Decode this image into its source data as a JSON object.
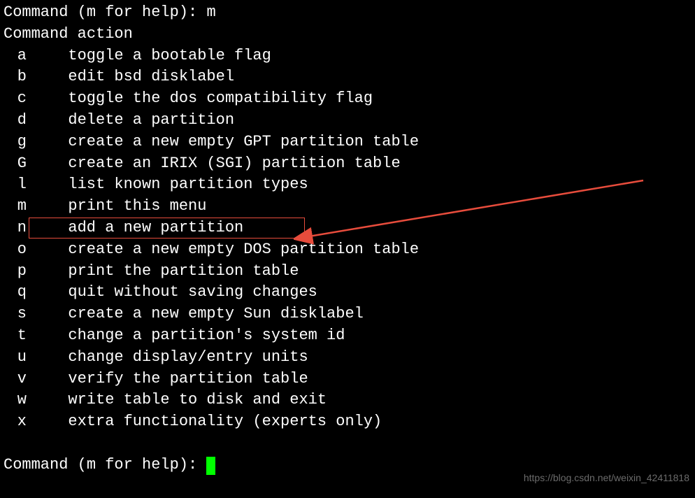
{
  "prompt_line_1": "Command (m for help): m",
  "header": "Command action",
  "menu": [
    {
      "key": "a",
      "desc": "toggle a bootable flag",
      "highlighted": false
    },
    {
      "key": "b",
      "desc": "edit bsd disklabel",
      "highlighted": false
    },
    {
      "key": "c",
      "desc": "toggle the dos compatibility flag",
      "highlighted": false
    },
    {
      "key": "d",
      "desc": "delete a partition",
      "highlighted": false
    },
    {
      "key": "g",
      "desc": "create a new empty GPT partition table",
      "highlighted": false
    },
    {
      "key": "G",
      "desc": "create an IRIX (SGI) partition table",
      "highlighted": false
    },
    {
      "key": "l",
      "desc": "list known partition types",
      "highlighted": false
    },
    {
      "key": "m",
      "desc": "print this menu",
      "highlighted": false
    },
    {
      "key": "n",
      "desc": "add a new partition",
      "highlighted": true
    },
    {
      "key": "o",
      "desc": "create a new empty DOS partition table",
      "highlighted": false
    },
    {
      "key": "p",
      "desc": "print the partition table",
      "highlighted": false
    },
    {
      "key": "q",
      "desc": "quit without saving changes",
      "highlighted": false
    },
    {
      "key": "s",
      "desc": "create a new empty Sun disklabel",
      "highlighted": false
    },
    {
      "key": "t",
      "desc": "change a partition's system id",
      "highlighted": false
    },
    {
      "key": "u",
      "desc": "change display/entry units",
      "highlighted": false
    },
    {
      "key": "v",
      "desc": "verify the partition table",
      "highlighted": false
    },
    {
      "key": "w",
      "desc": "write table to disk and exit",
      "highlighted": false
    },
    {
      "key": "x",
      "desc": "extra functionality (experts only)",
      "highlighted": false
    }
  ],
  "prompt_line_2": "Command (m for help): ",
  "watermark": "https://blog.csdn.net/weixin_42411818",
  "annotation": {
    "arrow_color": "#e74c3c",
    "box_color": "#e74c3c"
  }
}
